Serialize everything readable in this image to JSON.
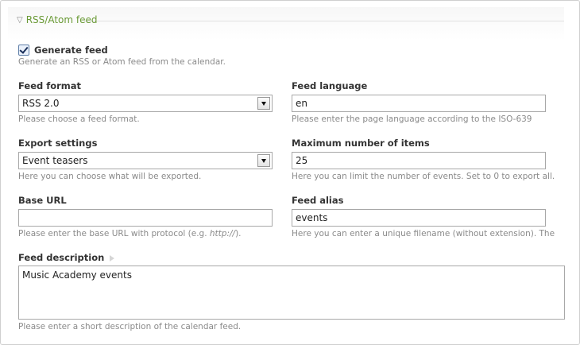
{
  "fieldset": {
    "legend": "RSS/Atom feed"
  },
  "generate_feed": {
    "label": "Generate feed",
    "checked": true,
    "help": "Generate an RSS or Atom feed from the calendar."
  },
  "feed_format": {
    "label": "Feed format",
    "value": "RSS 2.0",
    "help": "Please choose a feed format."
  },
  "feed_language": {
    "label": "Feed language",
    "value": "en",
    "help": "Please enter the page language according to the ISO-639"
  },
  "export_settings": {
    "label": "Export settings",
    "value": "Event teasers",
    "help": "Here you can choose what will be exported."
  },
  "max_items": {
    "label": "Maximum number of items",
    "value": "25",
    "help": "Here you can limit the number of events. Set to 0 to export all."
  },
  "base_url": {
    "label": "Base URL",
    "value": "",
    "help_pre": "Please enter the base URL with protocol (e.g. ",
    "help_em": "http://",
    "help_post": ")."
  },
  "feed_alias": {
    "label": "Feed alias",
    "value": "events",
    "help": "Here you can enter a unique filename (without extension). The"
  },
  "feed_description": {
    "label": "Feed description",
    "value": "Music Academy events",
    "help": "Please enter a short description of the calendar feed."
  }
}
